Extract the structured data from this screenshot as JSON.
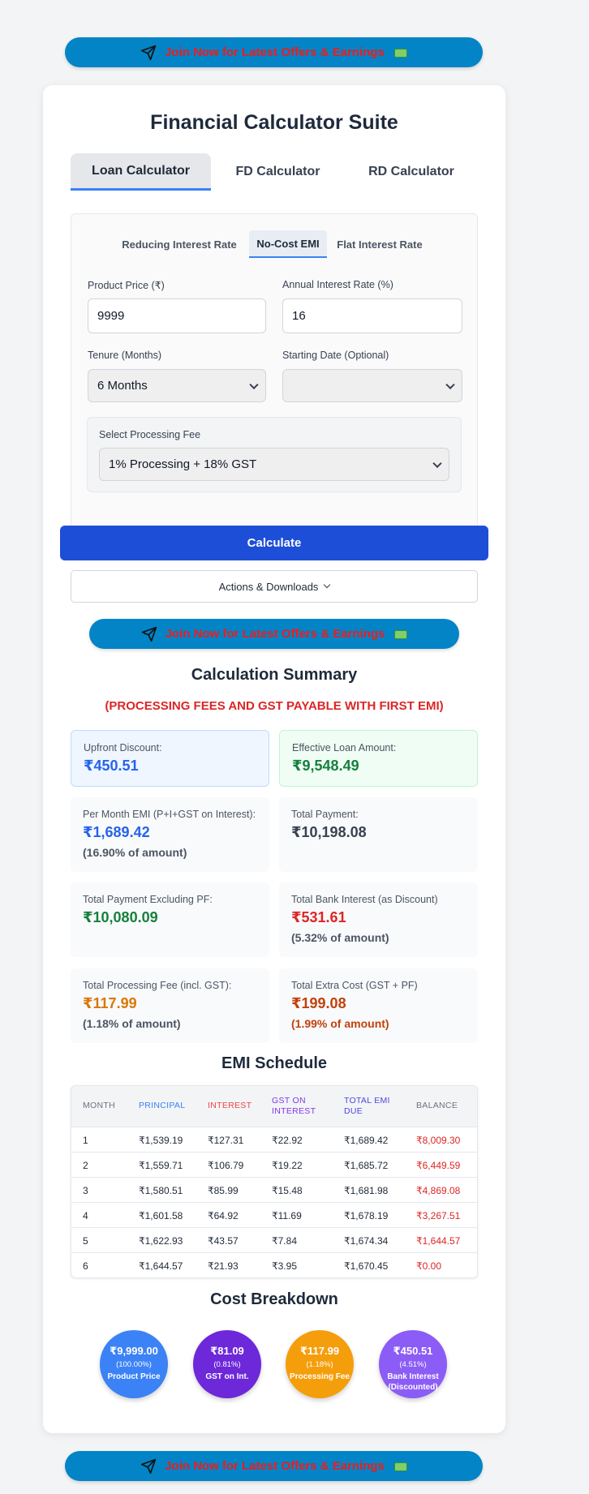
{
  "banner": {
    "text": "Join Now for Latest Offers & Earnings"
  },
  "title": "Financial Calculator Suite",
  "main_tabs": [
    "Loan Calculator",
    "FD Calculator",
    "RD Calculator"
  ],
  "sub_tabs": [
    "Reducing Interest Rate",
    "No-Cost EMI",
    "Flat Interest Rate"
  ],
  "form": {
    "product_price_label": "Product Price (₹)",
    "product_price_value": "9999",
    "interest_rate_label": "Annual Interest Rate (%)",
    "interest_rate_value": "16",
    "tenure_label": "Tenure (Months)",
    "tenure_value": "6 Months",
    "start_date_label": "Starting Date (Optional)",
    "start_date_value": "",
    "processing_fee_label": "Select Processing Fee",
    "processing_fee_value": "1% Processing + 18% GST"
  },
  "calculate_label": "Calculate",
  "actions_label": "Actions & Downloads",
  "summary": {
    "title": "Calculation Summary",
    "notice": "(PROCESSING FEES AND GST PAYABLE WITH FIRST EMI)",
    "upfront_label": "Upfront Discount:",
    "upfront_value": "₹450.51",
    "effective_label": "Effective Loan Amount:",
    "effective_value": "₹9,548.49",
    "emi_label": "Per Month EMI (P+I+GST on Interest):",
    "emi_value": "₹1,689.42",
    "emi_pct": "(16.90% of amount)",
    "total_payment_label": "Total Payment:",
    "total_payment_value": "₹10,198.08",
    "excl_pf_label": "Total Payment Excluding PF:",
    "excl_pf_value": "₹10,080.09",
    "bank_interest_label": "Total Bank Interest (as Discount)",
    "bank_interest_value": "₹531.61",
    "bank_interest_pct": "(5.32% of amount)",
    "pf_label": "Total Processing Fee (incl. GST):",
    "pf_value": "₹117.99",
    "pf_pct": "(1.18% of amount)",
    "extra_label": "Total Extra Cost (GST + PF)",
    "extra_value": "₹199.08",
    "extra_pct": "(1.99% of amount)"
  },
  "schedule": {
    "title": "EMI Schedule",
    "headers": {
      "month": "MONTH",
      "principal": "PRINCIPAL",
      "interest": "INTEREST",
      "gst_1": "GST ON",
      "gst_2": "INTEREST",
      "total_1": "TOTAL EMI",
      "total_2": "DUE",
      "balance": "BALANCE"
    },
    "rows": [
      [
        "1",
        "₹1,539.19",
        "₹127.31",
        "₹22.92",
        "₹1,689.42",
        "₹8,009.30"
      ],
      [
        "2",
        "₹1,559.71",
        "₹106.79",
        "₹19.22",
        "₹1,685.72",
        "₹6,449.59"
      ],
      [
        "3",
        "₹1,580.51",
        "₹85.99",
        "₹15.48",
        "₹1,681.98",
        "₹4,869.08"
      ],
      [
        "4",
        "₹1,601.58",
        "₹64.92",
        "₹11.69",
        "₹1,678.19",
        "₹3,267.51"
      ],
      [
        "5",
        "₹1,622.93",
        "₹43.57",
        "₹7.84",
        "₹1,674.34",
        "₹1,644.57"
      ],
      [
        "6",
        "₹1,644.57",
        "₹21.93",
        "₹3.95",
        "₹1,670.45",
        "₹0.00"
      ]
    ]
  },
  "breakdown": {
    "title": "Cost Breakdown",
    "items": [
      {
        "value": "₹9,999.00",
        "pct": "(100.00%)",
        "label1": "Product Price",
        "label2": "",
        "color": "#3b82f6"
      },
      {
        "value": "₹81.09",
        "pct": "(0.81%)",
        "label1": "GST on Int.",
        "label2": "",
        "color": "#6d28d9"
      },
      {
        "value": "₹117.99",
        "pct": "(1.18%)",
        "label1": "Processing Fee",
        "label2": "",
        "color": "#f59e0b"
      },
      {
        "value": "₹450.51",
        "pct": "(4.51%)",
        "label1": "Bank Interest",
        "label2": "(Discounted)",
        "color": "#8b5cf6"
      }
    ]
  },
  "colors": {
    "accent": "#1d4ed8",
    "banner": "#0284c7",
    "banner_text": "#ef1c1c",
    "blue_value": "#2563eb",
    "green_value": "#15803d",
    "red_value": "#dc2626",
    "orange_value": "#d97706"
  },
  "icons": {
    "banner": "send-icon",
    "money": "money-icon",
    "dropdown": "chevron-down-icon"
  }
}
